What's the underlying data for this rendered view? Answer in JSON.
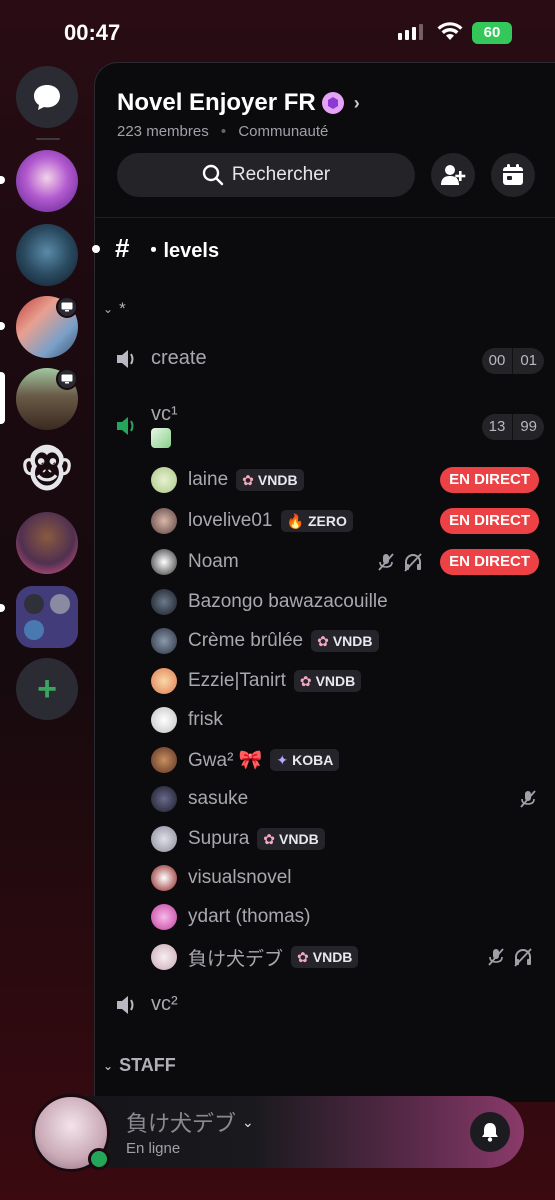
{
  "status_bar": {
    "time": "00:47",
    "battery": "60"
  },
  "server": {
    "name": "Novel Enjoyer FR",
    "members": "223 membres",
    "separator": "•",
    "type": "Communauté",
    "search_label": "Rechercher"
  },
  "channels": {
    "text": {
      "prefix": "#",
      "name": "・levels"
    },
    "category1": {
      "name": "*"
    },
    "voice_create": {
      "name": "create",
      "count": "00",
      "limit": "01"
    },
    "voice_vc1": {
      "name": "vc¹",
      "count": "13",
      "limit": "99"
    },
    "voice_vc2": {
      "name": "vc²"
    },
    "category_staff": {
      "name": "STAFF"
    }
  },
  "members": [
    {
      "name": "laine",
      "tag": "VNDB",
      "tag_icon": "flower-icon",
      "live": "EN DIRECT"
    },
    {
      "name": "lovelive01",
      "tag": "ZERO",
      "tag_icon": "flame-icon",
      "live": "EN DIRECT"
    },
    {
      "name": "Noam",
      "tag": "",
      "live": "EN DIRECT",
      "muted": true,
      "deafened": true
    },
    {
      "name": "Bazongo bawazacouille",
      "tag": ""
    },
    {
      "name": "Crème brûlée",
      "tag": "VNDB",
      "tag_icon": "flower-icon"
    },
    {
      "name": "Ezzie|Tanirt",
      "tag": "VNDB",
      "tag_icon": "flower-icon"
    },
    {
      "name": "frisk",
      "tag": ""
    },
    {
      "name": "Gwa² 🎀",
      "tag": "KOBA",
      "tag_icon": "sparkle-icon"
    },
    {
      "name": "sasuke",
      "tag": "",
      "mic_off": true
    },
    {
      "name": "Supura",
      "tag": "VNDB",
      "tag_icon": "flower-icon"
    },
    {
      "name": "visualsnovel",
      "tag": ""
    },
    {
      "name": "ydart (thomas)",
      "tag": ""
    },
    {
      "name": "負け犬デブ",
      "tag": "VNDB",
      "tag_icon": "flower-icon",
      "muted": true,
      "deafened": true
    }
  ],
  "user": {
    "name": "負け犬デブ",
    "status": "En ligne"
  },
  "colors": {
    "live": "#ed4245",
    "online": "#23a55a",
    "voice_active": "#23a55a",
    "add_server": "#3ba55d"
  }
}
